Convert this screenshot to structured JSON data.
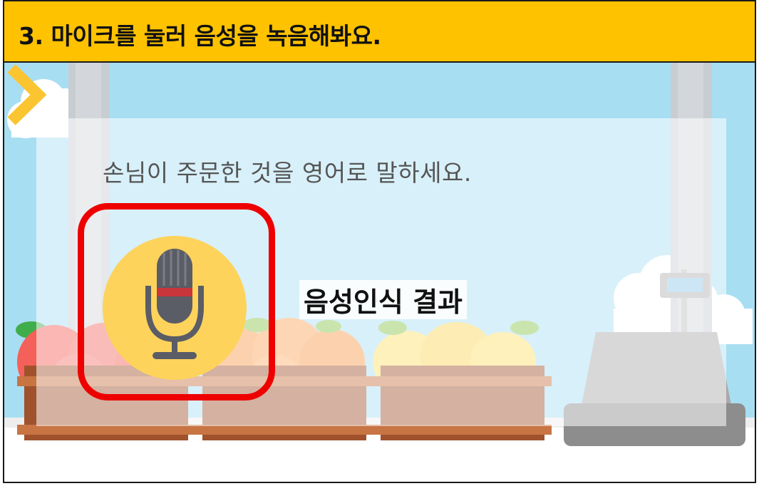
{
  "header": {
    "step_title": "3. 마이크를 눌러 음성을 녹음해봐요."
  },
  "scene": {
    "instruction": "손님이 주문한 것을 영어로 말하세요.",
    "result_label": "음성인식 결과"
  },
  "colors": {
    "header_bg": "#ffc200",
    "sky": "#a8def2",
    "mic_circle": "#fdd35c",
    "highlight": "#ee0000",
    "arrow": "#fbc531"
  },
  "icons": {
    "mic": "microphone-icon",
    "next": "chevron-right-icon"
  }
}
